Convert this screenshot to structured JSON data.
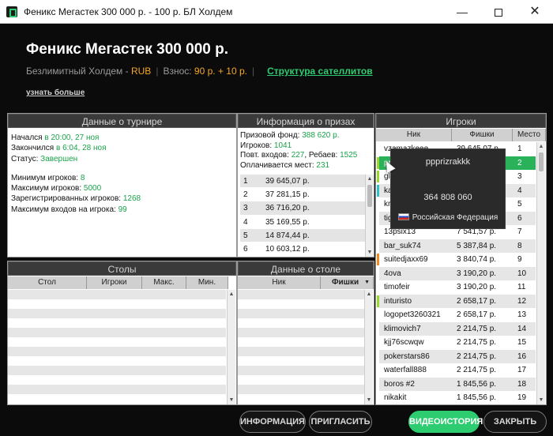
{
  "window": {
    "title": "Феникс Мегастек 300 000 р. - 100 р. БЛ Холдем",
    "min_label": "—",
    "close_label": "✕"
  },
  "header": {
    "title": "Феникс Мегастек 300 000 р.",
    "game": "Безлимитный Холдем - ",
    "currency": "RUB",
    "sep": "|",
    "buyin_label": "Взнос: ",
    "buyin_value": "90 р. + 10 р.",
    "satellites_link": "Структура сателлитов",
    "learn_more": "узнать больше"
  },
  "tournament": {
    "heading": "Данные о турнире",
    "started_label": "Начался ",
    "started_value": "в 20:00, 27 ноя",
    "ended_label": "Закончился ",
    "ended_value": "в 6:04, 28 ноя",
    "status_label": "Статус: ",
    "status_value": "Завершен",
    "min_players_label": "Минимум игроков: ",
    "min_players_value": "8",
    "max_players_label": "Максимум игроков: ",
    "max_players_value": "5000",
    "registered_label": "Зарегистрированных игроков: ",
    "registered_value": "1268",
    "max_entries_label": "Максимум входов на игрока: ",
    "max_entries_value": "99"
  },
  "prizes": {
    "heading": "Информация о призах",
    "pool_label": "Призовой фонд: ",
    "pool_value": "388 620 р.",
    "players_label": "Игроков: ",
    "players_value": "1041",
    "reentries_label": "Повт. входов: ",
    "reentries_value": "227",
    "rebuys_label": ", Ребаев: ",
    "rebuys_value": "1525",
    "paid_label": "Оплачивается мест: ",
    "paid_value": "231",
    "rows": [
      {
        "place": "1",
        "amount": "39 645,07 р."
      },
      {
        "place": "2",
        "amount": "37 281,15 р."
      },
      {
        "place": "3",
        "amount": "36 716,20 р."
      },
      {
        "place": "4",
        "amount": "35 169,55 р."
      },
      {
        "place": "5",
        "amount": "14 874,44 р."
      },
      {
        "place": "6",
        "amount": "10 603,12 р."
      }
    ]
  },
  "tables": {
    "heading": "Столы",
    "col_table": "Стол",
    "col_players": "Игроки",
    "col_max": "Макс.",
    "col_min": "Мин."
  },
  "table_data": {
    "heading": "Данные о столе",
    "col_nick": "Ник",
    "col_chips": "Фишки"
  },
  "players": {
    "heading": "Игроки",
    "col_nick": "Ник",
    "col_chips": "Фишки",
    "col_place": "Место",
    "rows": [
      {
        "nick": "vzamazkeee",
        "chips": "39 645,07 р.",
        "place": "1",
        "marker": ""
      },
      {
        "nick": "ppprizrakkk",
        "chips": "37 281,15 р.",
        "place": "2",
        "marker": "#9bd82f"
      },
      {
        "nick": "gl",
        "chips": "",
        "place": "3",
        "marker": "#9bd82f"
      },
      {
        "nick": "ka",
        "chips": "",
        "place": "4",
        "marker": "#2fc0c8"
      },
      {
        "nick": "kr",
        "chips": "",
        "place": "5",
        "marker": ""
      },
      {
        "nick": "tig",
        "chips": "",
        "place": "6",
        "marker": ""
      },
      {
        "nick": "13psix13",
        "chips": "7 541,57 р.",
        "place": "7",
        "marker": ""
      },
      {
        "nick": "bar_suk74",
        "chips": "5 387,84 р.",
        "place": "8",
        "marker": ""
      },
      {
        "nick": "suitedjaxx69",
        "chips": "3 840,74 р.",
        "place": "9",
        "marker": "#f08a24"
      },
      {
        "nick": "4ova",
        "chips": "3 190,20 р.",
        "place": "10",
        "marker": ""
      },
      {
        "nick": "timofeir",
        "chips": "3 190,20 р.",
        "place": "11",
        "marker": ""
      },
      {
        "nick": "inturisto",
        "chips": "2 658,17 р.",
        "place": "12",
        "marker": "#9bd82f"
      },
      {
        "nick": "logopet3260321",
        "chips": "2 658,17 р.",
        "place": "13",
        "marker": ""
      },
      {
        "nick": "klimovich7",
        "chips": "2 214,75 р.",
        "place": "14",
        "marker": ""
      },
      {
        "nick": "kjj76scwqw",
        "chips": "2 214,75 р.",
        "place": "15",
        "marker": ""
      },
      {
        "nick": "pokerstars86",
        "chips": "2 214,75 р.",
        "place": "16",
        "marker": ""
      },
      {
        "nick": "waterfall888",
        "chips": "2 214,75 р.",
        "place": "17",
        "marker": ""
      },
      {
        "nick": "boros #2",
        "chips": "1 845,56 р.",
        "place": "18",
        "marker": ""
      },
      {
        "nick": "nikakit",
        "chips": "1 845,56 р.",
        "place": "19",
        "marker": ""
      }
    ]
  },
  "tooltip": {
    "name": "ppprizrakkk",
    "number": "364 808 060",
    "country": "Российская Федерация"
  },
  "buttons": {
    "info": "ИНФОРМАЦИЯ",
    "invite": "ПРИГЛАСИТЬ",
    "video": "ВИДЕОИСТОРИЯ",
    "close": "ЗАКРЫТЬ"
  }
}
